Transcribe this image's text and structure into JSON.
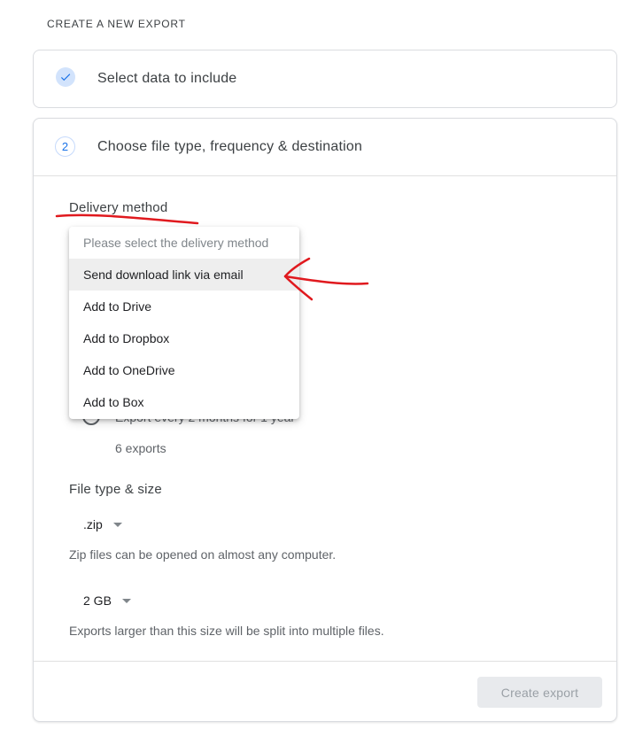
{
  "header": {
    "title": "CREATE A NEW EXPORT"
  },
  "step1": {
    "title": "Select data to include",
    "status": "done"
  },
  "step2": {
    "number": "2",
    "title": "Choose file type, frequency & destination",
    "delivery": {
      "label": "Delivery method",
      "options": [
        "Please select the delivery method",
        "Send download link via email",
        "Add to Drive",
        "Add to Dropbox",
        "Add to OneDrive",
        "Add to Box"
      ],
      "highlighted_index": 1
    },
    "frequency": {
      "option_text": "Export every 2 months for 1 year",
      "count_text": "6 exports"
    },
    "file_type": {
      "label": "File type & size",
      "type_value": ".zip",
      "type_helper": "Zip files can be opened on almost any computer.",
      "size_value": "2 GB",
      "size_helper": "Exports larger than this size will be split into multiple files."
    },
    "create_button": "Create export"
  },
  "colors": {
    "accent": "#1a73e8",
    "annotation": "#e0191e",
    "disabled_button": "#e8eaed"
  },
  "icons": {
    "step1": "check-icon"
  }
}
